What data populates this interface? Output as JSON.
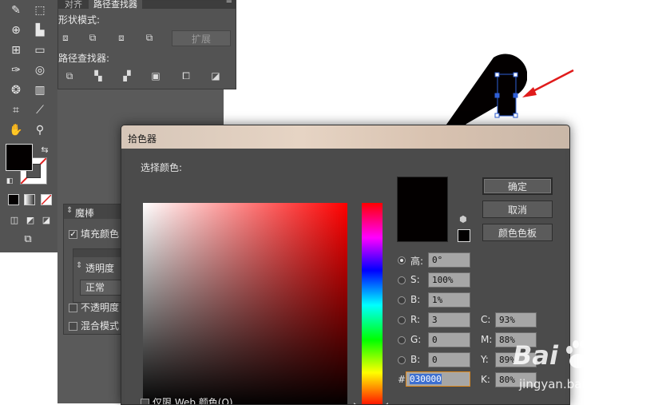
{
  "pathfinder_panel": {
    "tabs": [
      "对齐",
      "路径查找器"
    ],
    "shape_modes_label": "形状模式:",
    "expand_label": "扩展",
    "pathfinders_label": "路径查找器:"
  },
  "magic_wand_panel": {
    "title": "魔棒",
    "fill_color_label": "填充颜色",
    "opacity_label": "不透明度",
    "blend_mode_label": "混合模式"
  },
  "transparency_panel": {
    "title": "透明度",
    "mode_value": "正常"
  },
  "color_picker": {
    "title": "拾色器",
    "select_color_label": "选择颜色:",
    "ok_label": "确定",
    "cancel_label": "取消",
    "swatches_label": "颜色色板",
    "hsb": {
      "h_label": "高:",
      "h_value": "0°",
      "s_label": "S:",
      "s_value": "100%",
      "b_label": "B:",
      "b_value": "1%"
    },
    "rgb": {
      "r_label": "R:",
      "r_value": "3",
      "g_label": "G:",
      "g_value": "0",
      "b_label": "B:",
      "b_value": "0"
    },
    "cmyk": {
      "c_label": "C:",
      "c_value": "93%",
      "m_label": "M:",
      "m_value": "88%",
      "y_label": "Y:",
      "y_value": "89%",
      "k_label": "K:",
      "k_value": "80%"
    },
    "hex_label": "#",
    "hex_value": "030000",
    "web_only_label": "仅限 Web 颜色(O)",
    "current_color": "#030000"
  },
  "watermark": {
    "brand": "Bai",
    "brand2": "经验",
    "url": "jingyan.baidu.com"
  },
  "colors": {
    "panel_bg": "#535353",
    "dialog_bg": "#4a4a4a",
    "shape_fill": "#030000",
    "arrow": "#e01b1b",
    "selection": "#2f5fd6"
  }
}
